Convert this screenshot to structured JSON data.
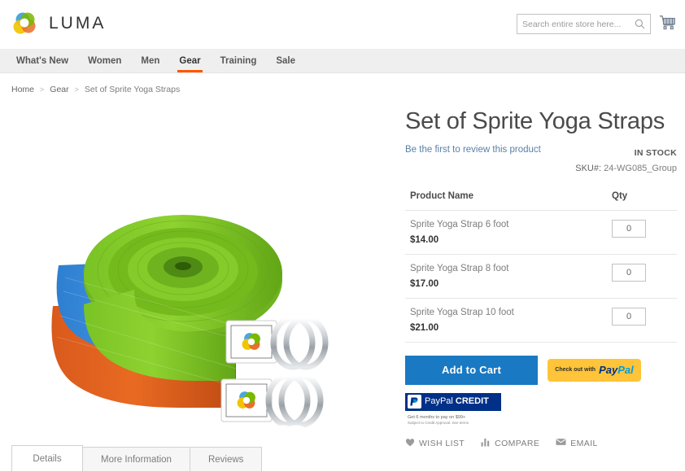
{
  "header": {
    "logo_text": "LUMA",
    "logo_icon": "luma-ring-logo",
    "search": {
      "placeholder": "Search entire store here...",
      "value": "",
      "icon": "search-icon"
    },
    "cart_icon": "shopping-cart-icon"
  },
  "nav": {
    "items": [
      {
        "label": "What's New",
        "active": false
      },
      {
        "label": "Women",
        "active": false
      },
      {
        "label": "Men",
        "active": false
      },
      {
        "label": "Gear",
        "active": true
      },
      {
        "label": "Training",
        "active": false
      },
      {
        "label": "Sale",
        "active": false
      }
    ],
    "active_color": "#ff5501"
  },
  "breadcrumb": {
    "items": [
      "Home",
      "Gear",
      "Set of Sprite Yoga Straps"
    ],
    "separator": ">"
  },
  "product": {
    "title": "Set of Sprite Yoga Straps",
    "review_link": "Be the first to review this product",
    "stock_status": "IN STOCK",
    "sku_label": "SKU#:",
    "sku_value": "24-WG085_Group",
    "image_alt": "Rolled green, blue and orange yoga straps with metal D-rings"
  },
  "grouped_table": {
    "headers": [
      "Product Name",
      "Qty"
    ],
    "rows": [
      {
        "name": "Sprite Yoga Strap 6 foot",
        "price": "$14.00",
        "qty": "0"
      },
      {
        "name": "Sprite Yoga Strap 8 foot",
        "price": "$17.00",
        "qty": "0"
      },
      {
        "name": "Sprite Yoga Strap 10 foot",
        "price": "$21.00",
        "qty": "0"
      }
    ]
  },
  "actions": {
    "add_to_cart": "Add to Cart",
    "add_to_cart_color": "#1979c3",
    "paypal": {
      "prefix": "Check out with",
      "brand_first": "Pay",
      "brand_second": "Pal",
      "bg_color": "#ffc439"
    },
    "paypal_credit": {
      "brand_first": "PayPal",
      "brand_second": "CREDIT",
      "bg_color": "#003087",
      "fine_print_1": "Get 6 months to pay on $99+",
      "fine_print_2": "Subject to Credit Approval. See terms"
    },
    "links": [
      {
        "label": "WISH LIST",
        "icon": "heart-icon"
      },
      {
        "label": "COMPARE",
        "icon": "bar-chart-icon"
      },
      {
        "label": "EMAIL",
        "icon": "envelope-icon"
      }
    ]
  },
  "tabs": [
    {
      "label": "Details",
      "active": true
    },
    {
      "label": "More Information",
      "active": false
    },
    {
      "label": "Reviews",
      "active": false
    }
  ]
}
